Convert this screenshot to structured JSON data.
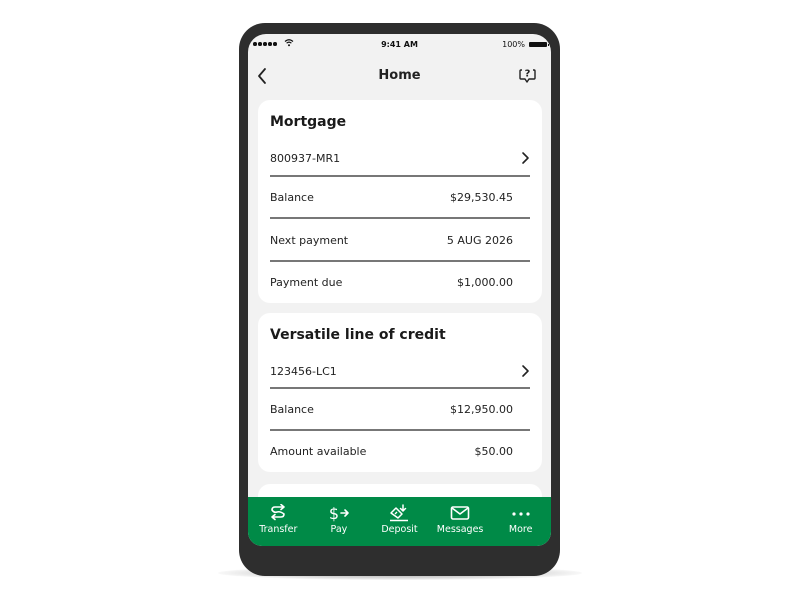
{
  "status_bar": {
    "time": "9:41 AM",
    "battery": "100%"
  },
  "header": {
    "title": "Home"
  },
  "accounts": [
    {
      "title": "Mortgage",
      "number": "800937-MR1",
      "rows": [
        {
          "label": "Balance",
          "value": "$29,530.45"
        },
        {
          "label": "Next payment",
          "value": "5 AUG 2026"
        },
        {
          "label": "Payment due",
          "value": "$1,000.00"
        }
      ]
    },
    {
      "title": "Versatile line of credit",
      "number": "123456-LC1",
      "rows": [
        {
          "label": "Balance",
          "value": "$12,950.00"
        },
        {
          "label": "Amount available",
          "value": "$50.00"
        }
      ]
    }
  ],
  "tabbar": {
    "color": "#008a47",
    "items": [
      {
        "label": "Transfer",
        "icon": "transfer-icon"
      },
      {
        "label": "Pay",
        "icon": "pay-icon"
      },
      {
        "label": "Deposit",
        "icon": "deposit-icon"
      },
      {
        "label": "Messages",
        "icon": "messages-icon"
      },
      {
        "label": "More",
        "icon": "more-icon"
      }
    ]
  }
}
